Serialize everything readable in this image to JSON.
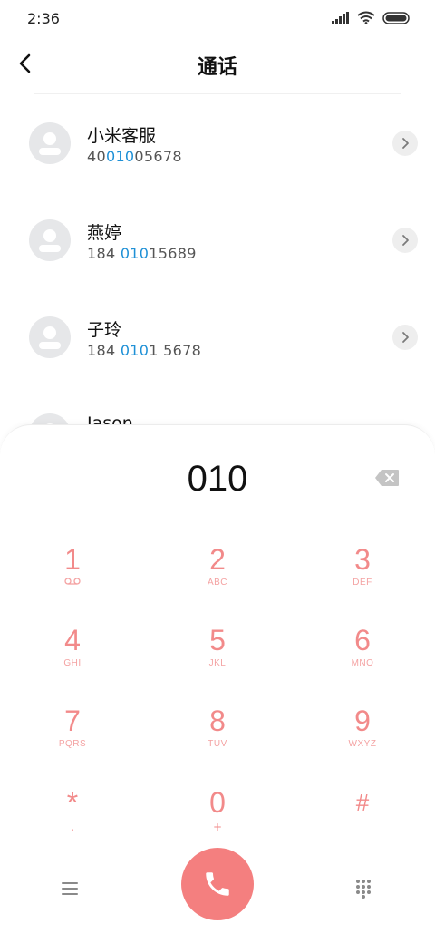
{
  "status_bar": {
    "time": "2:36"
  },
  "header": {
    "title": "通话"
  },
  "contacts": [
    {
      "name": "小米客服",
      "number_pre": "40",
      "number_match": "010",
      "number_post": "05678"
    },
    {
      "name": "燕婷",
      "number_pre": "184 ",
      "number_match": "010",
      "number_post": "15689"
    },
    {
      "name": "子玲",
      "number_pre": "184 ",
      "number_match": "010",
      "number_post": "1 5678"
    },
    {
      "name": "Jason",
      "number_pre": "",
      "number_match": "",
      "number_post": ""
    }
  ],
  "dialpad": {
    "dialed_number": "010",
    "keys": [
      {
        "digit": "1",
        "letters": ""
      },
      {
        "digit": "2",
        "letters": "ABC"
      },
      {
        "digit": "3",
        "letters": "DEF"
      },
      {
        "digit": "4",
        "letters": "GHI"
      },
      {
        "digit": "5",
        "letters": "JKL"
      },
      {
        "digit": "6",
        "letters": "MNO"
      },
      {
        "digit": "7",
        "letters": "PQRS"
      },
      {
        "digit": "8",
        "letters": "TUV"
      },
      {
        "digit": "9",
        "letters": "WXYZ"
      },
      {
        "digit": "*",
        "letters": ","
      },
      {
        "digit": "0",
        "letters": "+"
      },
      {
        "digit": "#",
        "letters": ""
      }
    ]
  },
  "colors": {
    "accent": "#f47f7f",
    "key_text": "#f28a8a",
    "match_highlight": "#1e90d6"
  },
  "icons": {
    "back": "chevron-left-icon",
    "backspace": "backspace-icon",
    "call": "phone-icon",
    "menu": "menu-icon",
    "keypad": "dialpad-grid-icon",
    "voicemail": "voicemail-icon",
    "detail": "chevron-right-icon"
  }
}
